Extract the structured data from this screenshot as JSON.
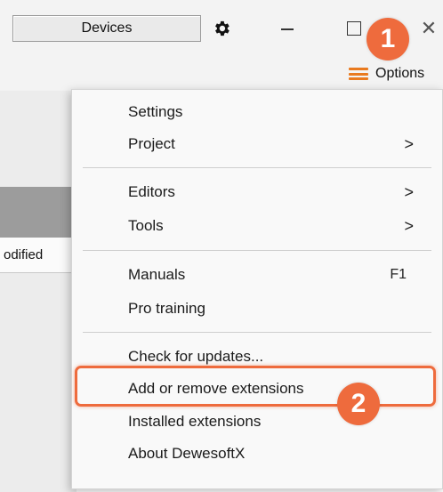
{
  "titlebar": {
    "devices_label": "Devices",
    "gear_icon": "gear-icon",
    "minimize_icon": "minimize-icon",
    "maximize_icon": "maximize-icon",
    "close_icon": "close-icon",
    "close_glyph": "✕"
  },
  "toolbar": {
    "options_label": "Options",
    "options_icon": "hamburger-menu-icon",
    "accent_color": "#e97a1f"
  },
  "background": {
    "column_header_text": "odified"
  },
  "menu": {
    "items": [
      {
        "label": "Settings"
      },
      {
        "label": "Project",
        "submenu": true
      },
      {
        "label": "Editors",
        "submenu": true
      },
      {
        "label": "Tools",
        "submenu": true
      },
      {
        "label": "Manuals",
        "shortcut": "F1"
      },
      {
        "label": "Pro training"
      },
      {
        "label": "Check for updates..."
      },
      {
        "label": "Add or remove extensions",
        "highlighted": true
      },
      {
        "label": "Installed extensions"
      },
      {
        "label": "About DewesoftX"
      }
    ],
    "submenu_arrow": ">"
  },
  "annotations": {
    "color": "#ee6b3d",
    "step1": "1",
    "step2": "2"
  }
}
